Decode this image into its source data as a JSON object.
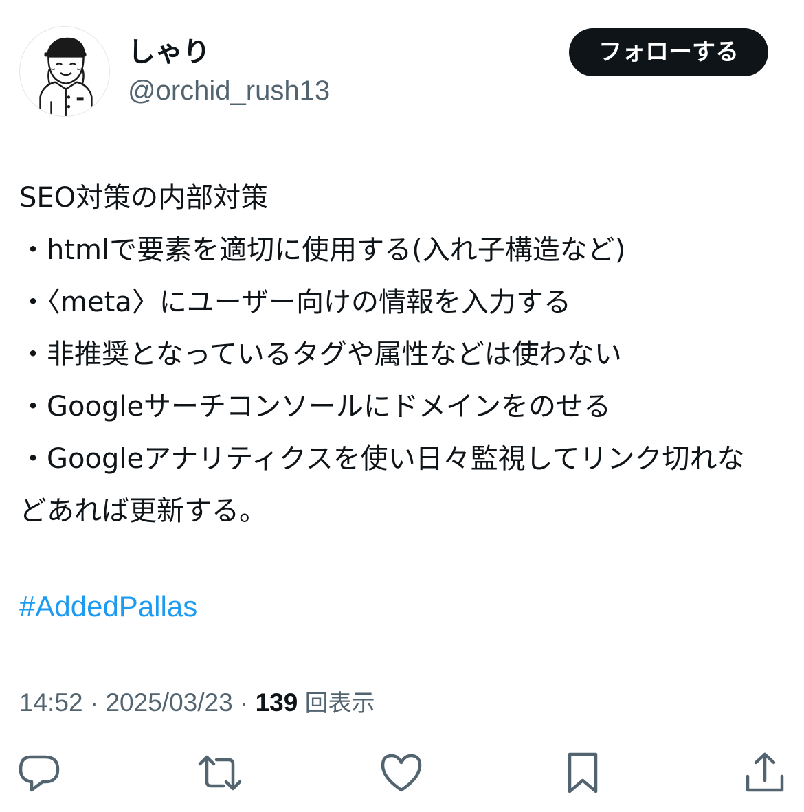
{
  "user": {
    "display_name": "しゃり",
    "handle": "@orchid_rush13"
  },
  "follow_button": {
    "label": "フォローする"
  },
  "tweet": {
    "lines": [
      "SEO対策の内部対策",
      "・htmlで要素を適切に使用する(入れ子構造など)",
      "・〈meta〉にユーザー向けの情報を入力する",
      "・非推奨となっているタグや属性などは使わない",
      "・Googleサーチコンソールにドメインをのせる",
      "・Googleアナリティクスを使い日々監視してリンク切れなどあれば更新する。"
    ],
    "hashtag": "#AddedPallas"
  },
  "meta": {
    "time": "14:52",
    "separator": " · ",
    "date": "2025/03/23",
    "views_count": "139",
    "views_label": "回表示"
  },
  "actions": {
    "reply_icon": "reply-icon",
    "retweet_icon": "retweet-icon",
    "like_icon": "heart-icon",
    "bookmark_icon": "bookmark-icon",
    "share_icon": "share-icon"
  },
  "colors": {
    "text": "#0f1419",
    "secondary": "#536471",
    "link": "#1d9bf0",
    "button_bg": "#0f1419",
    "button_text": "#ffffff"
  }
}
